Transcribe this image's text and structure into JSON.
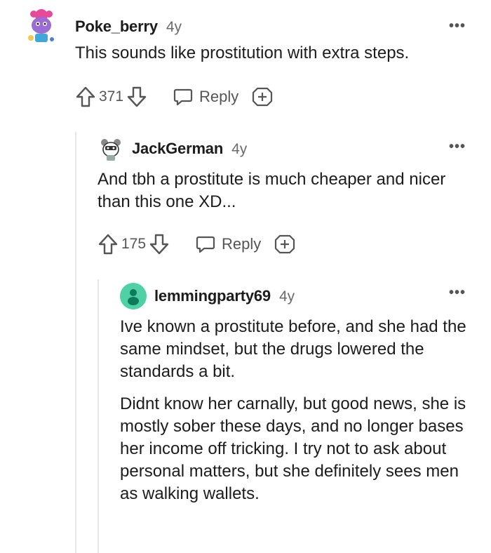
{
  "comments": [
    {
      "username": "Poke_berry",
      "age": "4y",
      "paragraphs": [
        "This sounds like prostitution with extra steps."
      ],
      "votes": "371",
      "reply_label": "Reply",
      "more": "•••"
    },
    {
      "username": "JackGerman",
      "age": "4y",
      "paragraphs": [
        "And tbh a prostitute is much cheaper and nicer than this one XD..."
      ],
      "votes": "175",
      "reply_label": "Reply",
      "more": "•••"
    },
    {
      "username": "lemmingparty69",
      "age": "4y",
      "paragraphs": [
        "Ive known a prostitute before, and she had the same mindset, but the drugs lowered the standards a bit.",
        "Didnt know her carnally, but good news, she is mostly sober these days, and no longer bases her income off tricking. I try not to ask about personal matters, but she definitely sees men as walking wallets."
      ],
      "more": "•••"
    }
  ],
  "colors": {
    "text": "#1c1c1c",
    "meta": "#6b6b6b",
    "thread": "#e6e6e6",
    "avatar3": "#4fd1a5"
  }
}
